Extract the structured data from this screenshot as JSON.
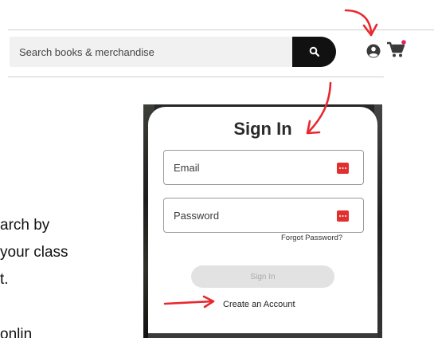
{
  "header": {
    "search": {
      "placeholder": "Search books & merchandise",
      "icon": "search-icon"
    },
    "icons": [
      "account-icon",
      "cart-icon"
    ],
    "colors": {
      "search_button": "#111111",
      "cart_badge": "#e0245e"
    }
  },
  "background_text": {
    "lines": [
      "arch by",
      "your class",
      "t.",
      "onlin"
    ]
  },
  "signin_modal": {
    "title": "Sign In",
    "email_label": "Email",
    "password_label": "Password",
    "forgot_password": "Forgot Password?",
    "sign_in_button": "Sign In",
    "create_account": "Create an Account"
  },
  "annotations": {
    "arrow_color": "#e8282e",
    "arrows": [
      "arrow-to-account-icon",
      "arrow-to-sign-in-title",
      "arrow-to-create-account"
    ]
  }
}
